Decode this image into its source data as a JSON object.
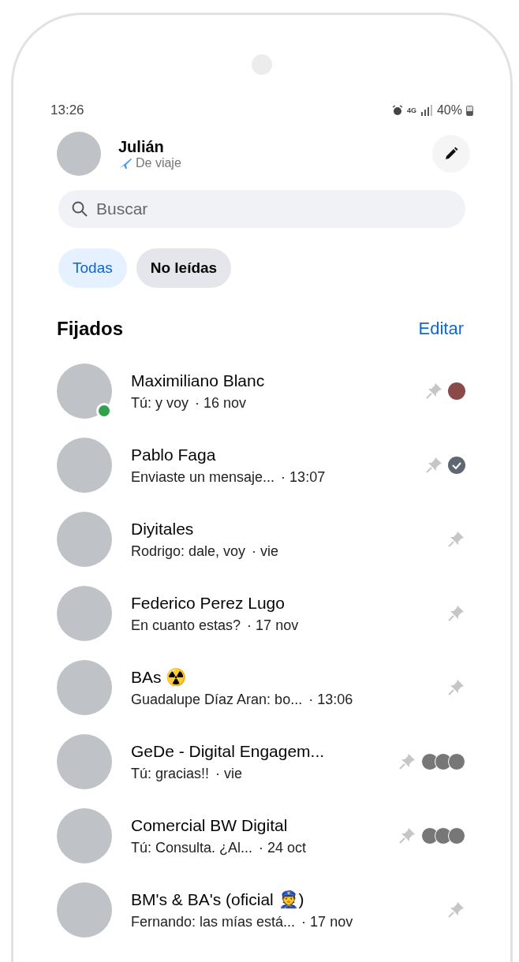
{
  "status_bar": {
    "time": "13:26",
    "network": "4G",
    "battery": "40%"
  },
  "profile": {
    "name": "Julián",
    "status": "De viaje"
  },
  "search": {
    "placeholder": "Buscar"
  },
  "filters": [
    {
      "label": "Todas",
      "selected": true
    },
    {
      "label": "No leídas",
      "selected": false
    }
  ],
  "pinned_section": {
    "title": "Fijados",
    "edit": "Editar"
  },
  "conversations": [
    {
      "name": "Maximiliano Blanc",
      "preview": "Tú: y voy",
      "time": "· 16 nov",
      "online": true,
      "pinned": true,
      "kind": "avatar"
    },
    {
      "name": "Pablo Faga",
      "preview": "Enviaste un mensaje...",
      "time": "· 13:07",
      "online": false,
      "pinned": true,
      "kind": "check"
    },
    {
      "name": "Diyitales",
      "preview": "Rodrigo: dale, voy",
      "time": "· vie",
      "online": false,
      "pinned": true,
      "kind": "plain"
    },
    {
      "name": "Federico Perez Lugo",
      "preview": "En cuanto estas?",
      "time": "· 17 nov",
      "online": false,
      "pinned": true,
      "kind": "plain"
    },
    {
      "name": "BAs ☢️",
      "preview": "Guadalupe Díaz Aran: bo...",
      "time": "· 13:06",
      "online": false,
      "pinned": true,
      "kind": "plain"
    },
    {
      "name": "GeDe - Digital Engagem...",
      "preview": "Tú: gracias!!",
      "time": "· vie",
      "online": false,
      "pinned": true,
      "kind": "group"
    },
    {
      "name": "Comercial BW Digital",
      "preview": "Tú: Consulta. ¿Al...",
      "time": "· 24 oct",
      "online": false,
      "pinned": true,
      "kind": "group"
    },
    {
      "name": "BM's & BA's (oficial 👮)",
      "preview": "Fernando: las mías está...",
      "time": "· 17 nov",
      "online": false,
      "pinned": true,
      "kind": "plain"
    }
  ]
}
